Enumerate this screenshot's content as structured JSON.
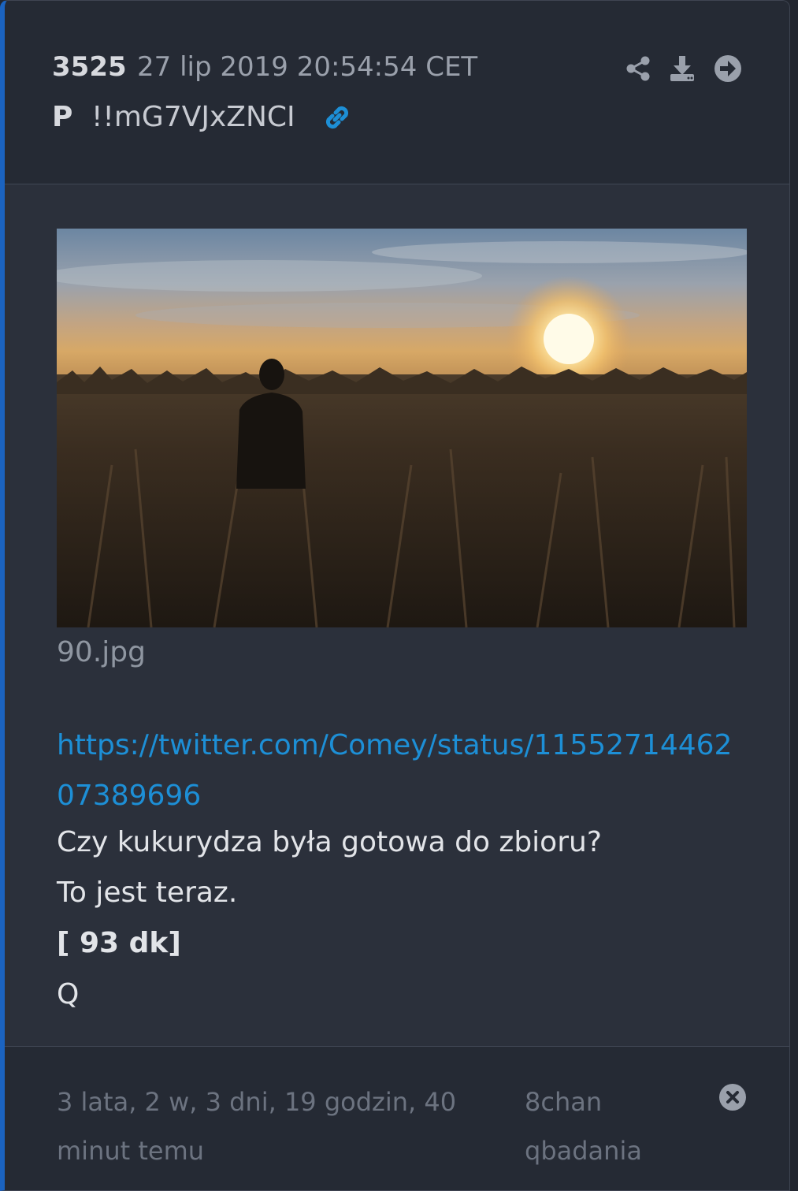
{
  "post": {
    "number": "3525",
    "date": "27 lip 2019 20:54:54 CET",
    "author": "P",
    "tripcode": "!!mG7VJxZNCI",
    "icons": [
      "link-icon",
      "share-icon",
      "download-icon",
      "arrow-right-circle-icon"
    ]
  },
  "attachment": {
    "filename": "90.jpg",
    "image_description": "photo"
  },
  "body": {
    "link": "https://twitter.com/Comey/status/1155271446207389696",
    "line1": "Czy kukurydza była gotowa do zbioru?",
    "line2": "To jest teraz.",
    "line3": "[ 93 dk]",
    "line4": "Q"
  },
  "footer": {
    "elapsed": "3 lata, 2 w, 3 dni, 19 godzin, 40 minut temu",
    "board": "8chan qbadania",
    "icon": "close-icon"
  },
  "colors": {
    "accent": "#1b63c0",
    "link": "#1d8fd6",
    "background": "#2b303b"
  }
}
